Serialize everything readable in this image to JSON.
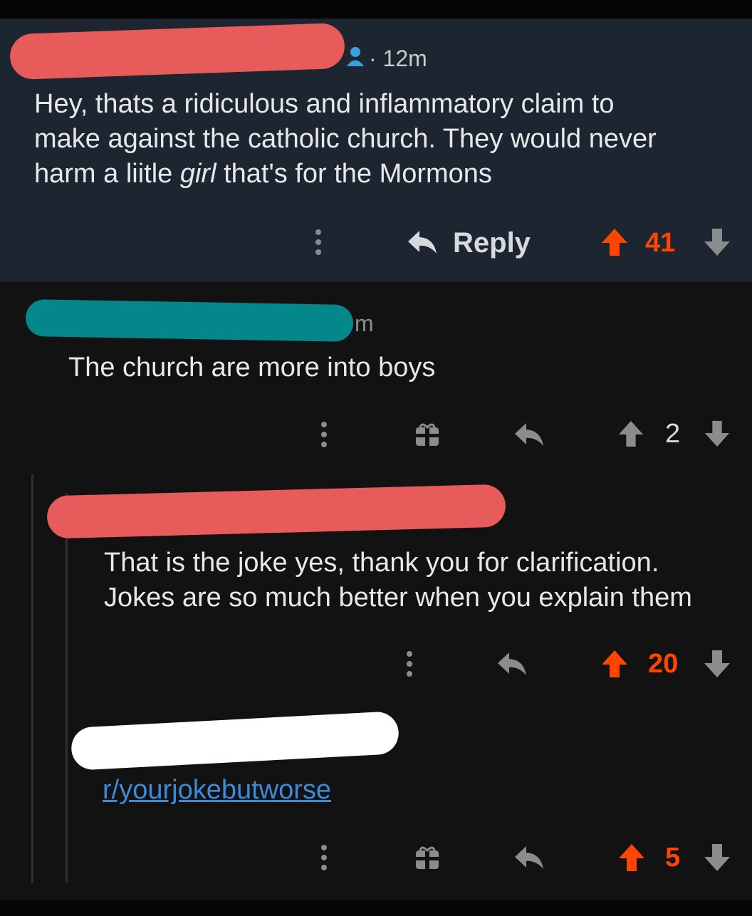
{
  "comment_1": {
    "time": "12m",
    "dot": "·",
    "body_before": "Hey, thats a ridiculous and inflammatory claim to",
    "body_line2": "make against the catholic church. They would never",
    "body_line3_a": "harm a liitle ",
    "body_line3_italic": "girl",
    "body_line3_b": " that's for the Mormons",
    "reply_label": "Reply",
    "score": "41",
    "colors": {
      "upvoted": "#ff4500",
      "background": "#1c2530"
    }
  },
  "comment_2": {
    "time_fragment": "m",
    "body": "The church are more into boys",
    "score": "2",
    "icons": [
      "more-icon",
      "award-icon",
      "reply-icon",
      "upvote-icon",
      "downvote-icon"
    ]
  },
  "comment_3": {
    "body_line1": "That is the joke yes, thank you for clarification.",
    "body_line2": "Jokes are so much better when you explain them",
    "score": "20",
    "icons": [
      "more-icon",
      "reply-icon",
      "upvote-icon",
      "downvote-icon"
    ]
  },
  "comment_4": {
    "link": "r/yourjokebutworse",
    "score": "5",
    "icons": [
      "more-icon",
      "award-icon",
      "reply-icon",
      "upvote-icon",
      "downvote-icon"
    ]
  }
}
